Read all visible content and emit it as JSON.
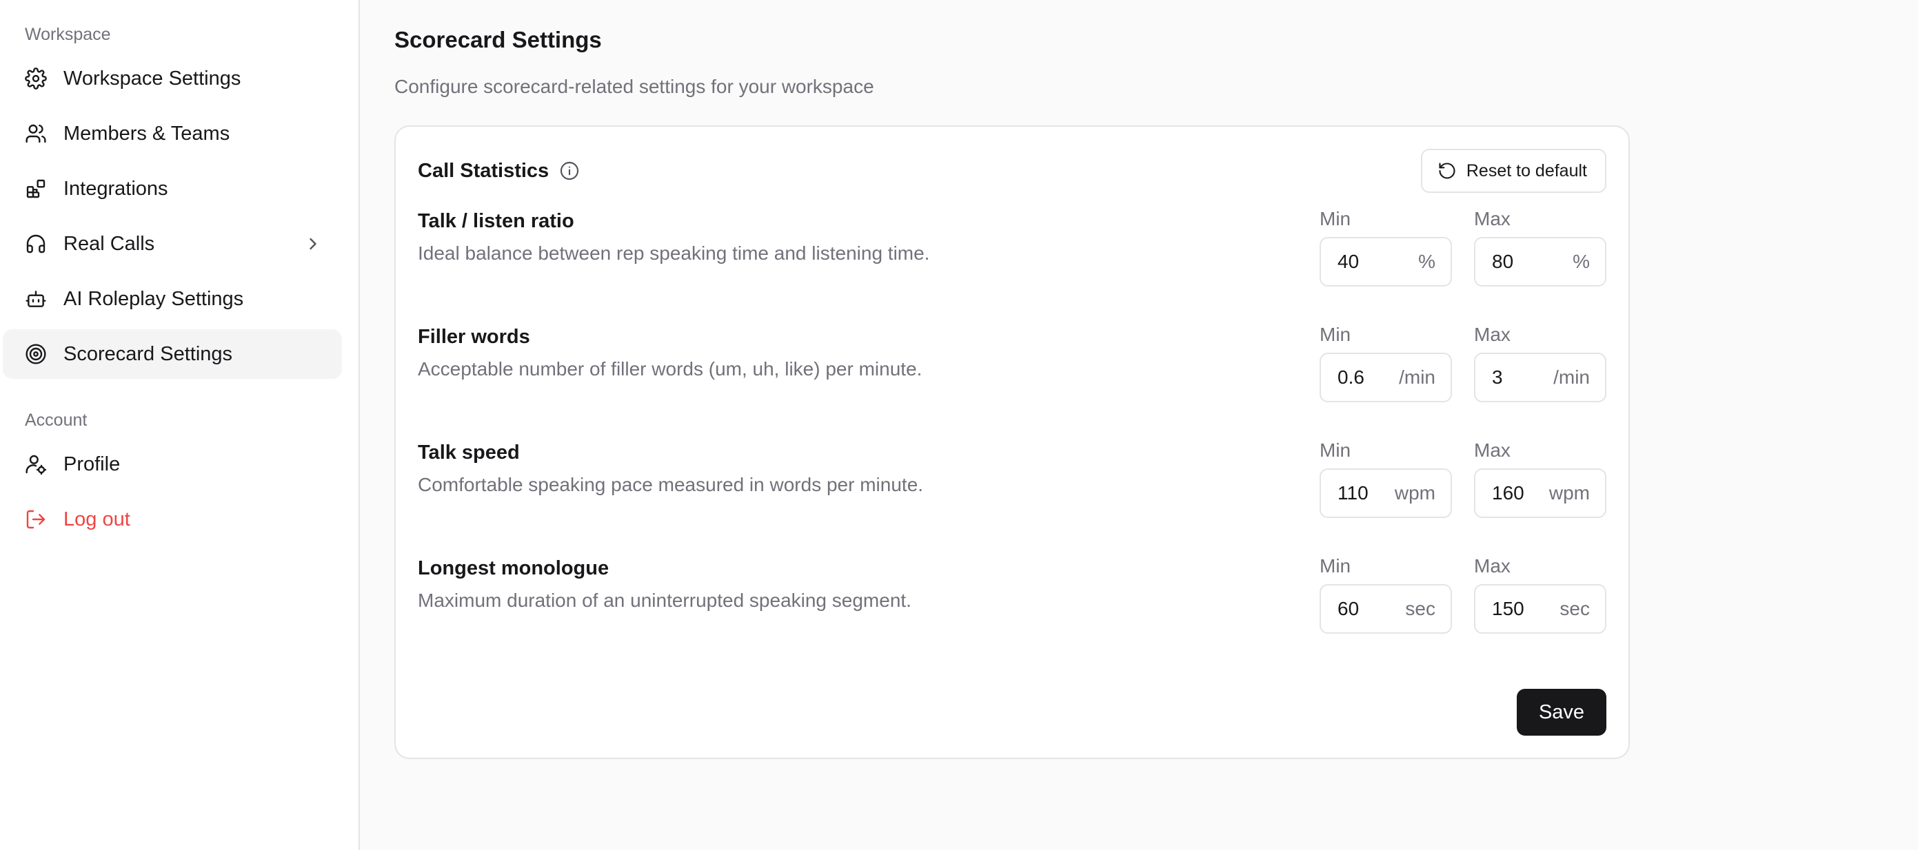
{
  "sidebar": {
    "workspace_label": "Workspace",
    "workspace_items": [
      {
        "label": "Workspace Settings",
        "icon": "gear-icon"
      },
      {
        "label": "Members & Teams",
        "icon": "users-icon"
      },
      {
        "label": "Integrations",
        "icon": "integrations-icon"
      },
      {
        "label": "Real Calls",
        "icon": "headset-icon"
      },
      {
        "label": "AI Roleplay Settings",
        "icon": "bot-icon"
      },
      {
        "label": "Scorecard Settings",
        "icon": "target-icon",
        "active": true
      }
    ],
    "account_label": "Account",
    "account_items": [
      {
        "label": "Profile",
        "icon": "user-gear-icon"
      },
      {
        "label": "Log out",
        "icon": "logout-icon",
        "color": "#ef4444"
      }
    ]
  },
  "main": {
    "title": "Scorecard Settings",
    "subtitle": "Configure scorecard-related settings for your workspace",
    "card": {
      "title": "Call Statistics",
      "reset_label": "Reset to default",
      "save_label": "Save",
      "metrics": [
        {
          "title": "Talk / listen ratio",
          "description": "Ideal balance between rep speaking time and listening time.",
          "min_label": "Min",
          "min_value": "40",
          "min_unit": "%",
          "max_label": "Max",
          "max_value": "80",
          "max_unit": "%"
        },
        {
          "title": "Filler words",
          "description": "Acceptable number of filler words (um, uh, like) per minute.",
          "min_label": "Min",
          "min_value": "0.6",
          "min_unit": "/min",
          "max_label": "Max",
          "max_value": "3",
          "max_unit": "/min"
        },
        {
          "title": "Talk speed",
          "description": "Comfortable speaking pace measured in words per minute.",
          "min_label": "Min",
          "min_value": "110",
          "min_unit": "wpm",
          "max_label": "Max",
          "max_value": "160",
          "max_unit": "wpm"
        },
        {
          "title": "Longest monologue",
          "description": "Maximum duration of an uninterrupted speaking segment.",
          "min_label": "Min",
          "min_value": "60",
          "min_unit": "sec",
          "max_label": "Max",
          "max_value": "150",
          "max_unit": "sec"
        }
      ]
    }
  },
  "colors": {
    "accent_dark": "#18181b",
    "muted_text": "#71717a",
    "danger": "#ef4444",
    "border": "#e4e4e7"
  }
}
